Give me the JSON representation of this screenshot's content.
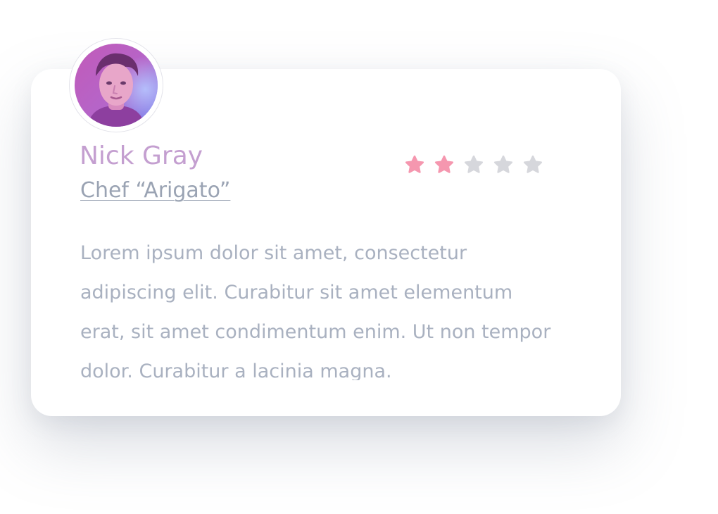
{
  "reviewer": {
    "name": "Nick Gray",
    "role": "Chef “Arigato”"
  },
  "rating": {
    "value": 2,
    "max": 5,
    "filled_color": "#f597af",
    "empty_color": "#d6d7dc",
    "icon": "star-icon"
  },
  "review": {
    "text": "Lorem ipsum dolor sit amet, consectetur adipiscing elit. Curabitur sit amet elementum erat, sit amet condimentum enim. Ut non tempor dolor. Curabitur a lacinia magna."
  },
  "colors": {
    "name": "#c49fd0",
    "role": "#9aa3b3",
    "body": "#a9b1c0"
  }
}
